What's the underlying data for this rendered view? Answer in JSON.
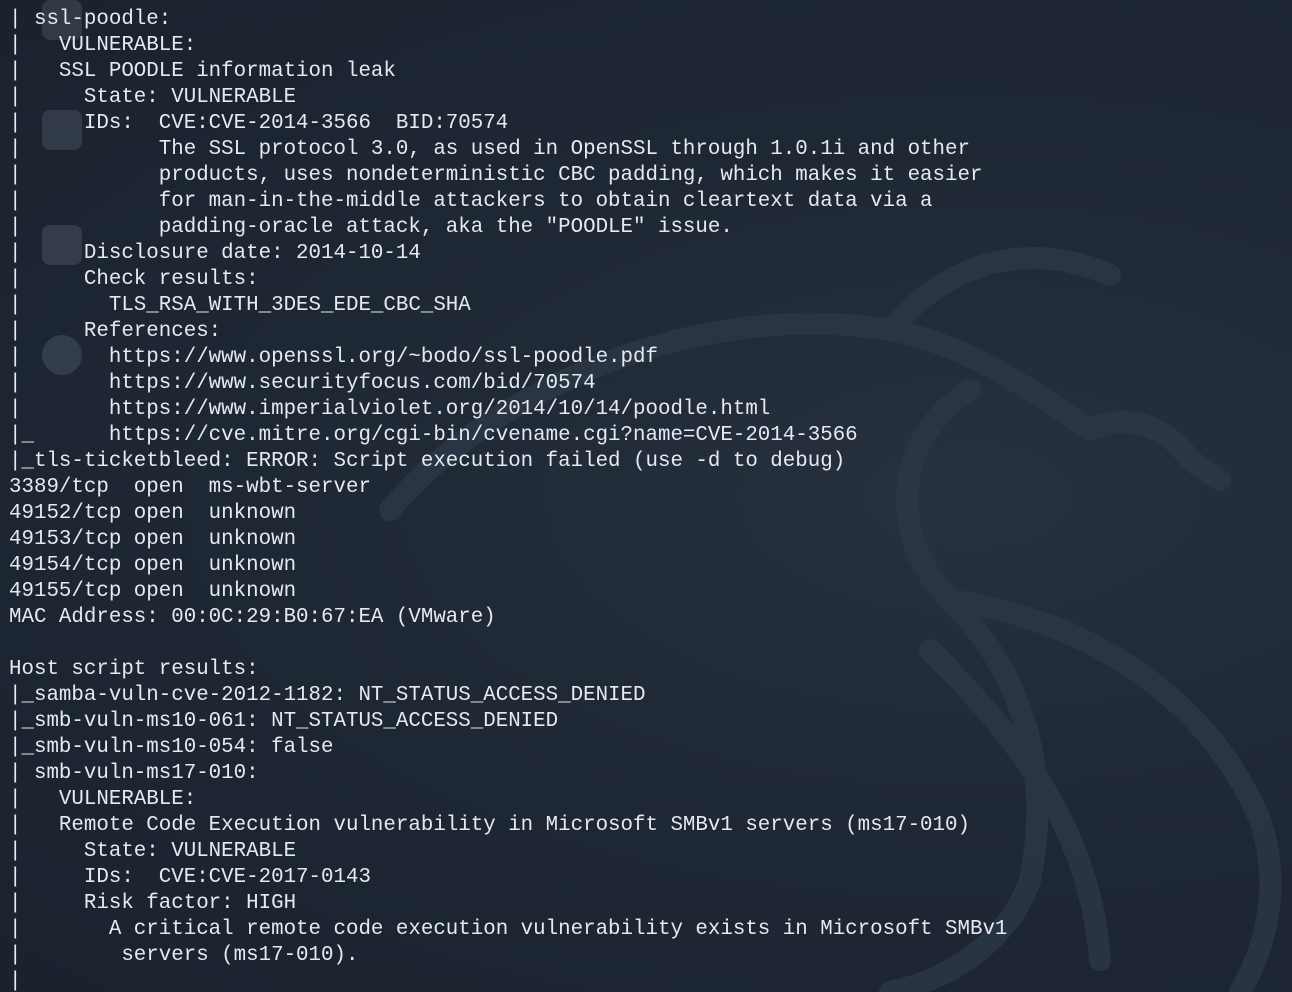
{
  "theme": {
    "background": "#1c2532",
    "text": "#e6e9ee"
  },
  "terminal": {
    "lines": [
      "| ssl-poodle:",
      "|   VULNERABLE:",
      "|   SSL POODLE information leak",
      "|     State: VULNERABLE",
      "|     IDs:  CVE:CVE-2014-3566  BID:70574",
      "|           The SSL protocol 3.0, as used in OpenSSL through 1.0.1i and other",
      "|           products, uses nondeterministic CBC padding, which makes it easier",
      "|           for man-in-the-middle attackers to obtain cleartext data via a",
      "|           padding-oracle attack, aka the \"POODLE\" issue.",
      "|     Disclosure date: 2014-10-14",
      "|     Check results:",
      "|       TLS_RSA_WITH_3DES_EDE_CBC_SHA",
      "|     References:",
      "|       https://www.openssl.org/~bodo/ssl-poodle.pdf",
      "|       https://www.securityfocus.com/bid/70574",
      "|       https://www.imperialviolet.org/2014/10/14/poodle.html",
      "|_      https://cve.mitre.org/cgi-bin/cvename.cgi?name=CVE-2014-3566",
      "|_tls-ticketbleed: ERROR: Script execution failed (use -d to debug)",
      "3389/tcp  open  ms-wbt-server",
      "49152/tcp open  unknown",
      "49153/tcp open  unknown",
      "49154/tcp open  unknown",
      "49155/tcp open  unknown",
      "MAC Address: 00:0C:29:B0:67:EA (VMware)",
      "",
      "Host script results:",
      "|_samba-vuln-cve-2012-1182: NT_STATUS_ACCESS_DENIED",
      "|_smb-vuln-ms10-061: NT_STATUS_ACCESS_DENIED",
      "|_smb-vuln-ms10-054: false",
      "| smb-vuln-ms17-010:",
      "|   VULNERABLE:",
      "|   Remote Code Execution vulnerability in Microsoft SMBv1 servers (ms17-010)",
      "|     State: VULNERABLE",
      "|     IDs:  CVE:CVE-2017-0143",
      "|     Risk factor: HIGH",
      "|       A critical remote code execution vulnerability exists in Microsoft SMBv1",
      "|        servers (ms17-010).",
      "|"
    ]
  }
}
